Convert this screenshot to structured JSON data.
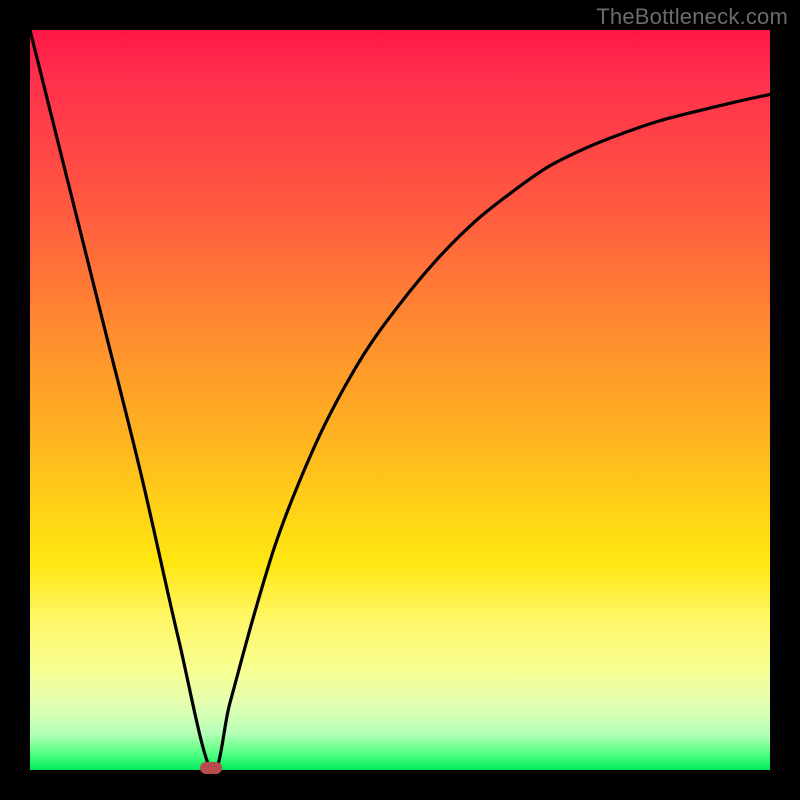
{
  "watermark": "TheBottleneck.com",
  "colors": {
    "frame": "#000000",
    "curve": "#000000",
    "marker": "#b84b4b"
  },
  "chart_data": {
    "type": "line",
    "title": "",
    "xlabel": "",
    "ylabel": "",
    "xlim": [
      0,
      100
    ],
    "ylim": [
      0,
      100
    ],
    "grid": false,
    "legend": false,
    "note": "x and y are percentage of plot area (0=left/bottom, 100=right/top); values estimated from pixels",
    "series": [
      {
        "name": "bottleneck-curve",
        "x": [
          0,
          5,
          10,
          15,
          20,
          24.5,
          27,
          30,
          33,
          36,
          40,
          45,
          50,
          55,
          60,
          65,
          70,
          75,
          80,
          85,
          90,
          95,
          100
        ],
        "y": [
          100,
          80,
          60,
          40,
          18,
          0,
          9,
          20,
          30,
          38,
          47,
          56,
          63,
          69,
          74,
          78,
          81.5,
          84,
          86,
          87.7,
          89,
          90.2,
          91.3
        ]
      }
    ],
    "marker": {
      "x": 24.5,
      "y": 0
    },
    "background_gradient": [
      {
        "stop": 0,
        "color": "#ff1746"
      },
      {
        "stop": 40,
        "color": "#ff8a30"
      },
      {
        "stop": 72,
        "color": "#ffe712"
      },
      {
        "stop": 95,
        "color": "#b8ffb8"
      },
      {
        "stop": 100,
        "color": "#00e85e"
      }
    ]
  }
}
